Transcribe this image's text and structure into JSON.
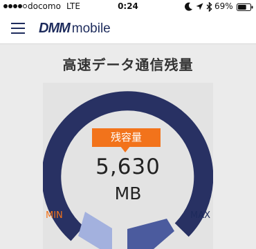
{
  "status_bar": {
    "signal_bars_filled": 4,
    "signal_bars_total": 5,
    "carrier": "docomo",
    "network": "LTE",
    "time": "0:24",
    "battery_percent": "69%",
    "battery_level": 0.69,
    "icons": [
      "moon-icon",
      "location-arrow-icon",
      "bluetooth-icon",
      "battery-icon"
    ]
  },
  "nav": {
    "menu_icon": "hamburger-menu-icon",
    "logo_brand": "DMM",
    "logo_product": "mobile"
  },
  "page": {
    "title": "高速データ通信残量"
  },
  "gauge": {
    "badge_label": "残容量",
    "value": "5,630",
    "unit": "MB",
    "min_label": "MIN",
    "max_label": "MAX"
  },
  "colors": {
    "navy": "#283163",
    "accent_orange": "#f2731b",
    "min_segment": "#a3b1de",
    "max_segment": "#4b5b9e",
    "gauge_background": "#e3e3e3"
  }
}
